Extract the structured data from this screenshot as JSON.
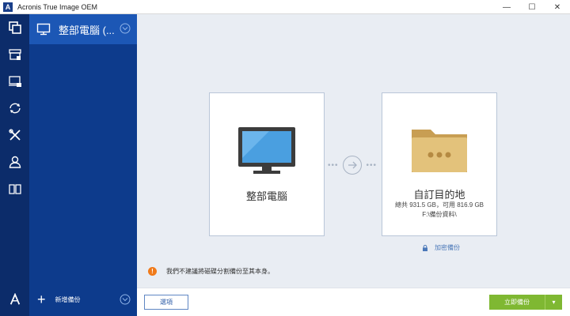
{
  "window": {
    "title": "Acronis True Image OEM",
    "logo_letter": "A",
    "minimize_glyph": "—",
    "maximize_glyph": "☐",
    "close_glyph": "✕"
  },
  "rail": {
    "items": [
      {
        "icon": "backup-icon",
        "active": true
      },
      {
        "icon": "archive-icon",
        "active": false
      },
      {
        "icon": "computer-lock-icon",
        "active": false
      },
      {
        "icon": "sync-icon",
        "active": false
      },
      {
        "icon": "tools-icon",
        "active": false
      },
      {
        "icon": "account-icon",
        "active": false
      },
      {
        "icon": "help-book-icon",
        "active": false
      }
    ],
    "bottom_logo": "A"
  },
  "backup_list": {
    "selected_label": "整部電腦 (...",
    "add_label": "新增備份",
    "add_glyph": "+"
  },
  "source": {
    "title": "整部電腦",
    "icon": "monitor-icon"
  },
  "destination": {
    "title": "自訂目的地",
    "capacity": "總共 931.5 GB，可用 816.9 GB",
    "path": "F:\\備份資料\\",
    "icon": "folder-icon"
  },
  "encrypt": {
    "label": "加密備份"
  },
  "warning": {
    "icon_glyph": "!",
    "text": "我們不建議將磁碟分割備份至其本身。"
  },
  "footer": {
    "options_label": "選項",
    "backup_now_label": "立即備份",
    "dropdown_glyph": "▾"
  },
  "colors": {
    "rail": "#0c2c6a",
    "panel": "#0d3b8c",
    "selected": "#1c57b5",
    "main_bg": "#e9edf3",
    "accent_green": "#7fb832",
    "warning_orange": "#f07a1a"
  }
}
